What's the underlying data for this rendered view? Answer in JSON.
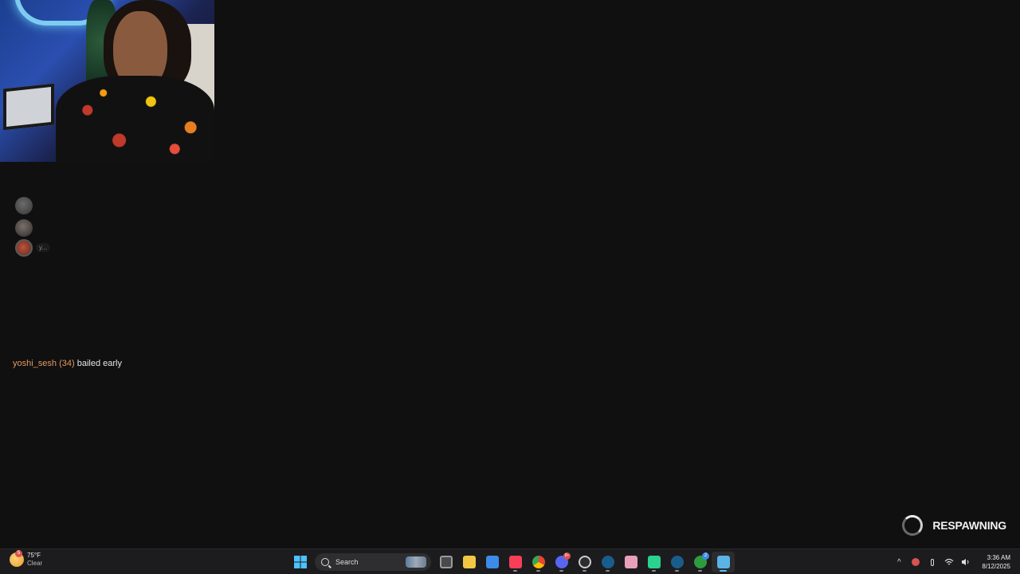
{
  "stream": {
    "webcam_label": "",
    "viewer_avatars": [
      {
        "label": ""
      },
      {
        "label": ""
      },
      {
        "label": "y..."
      }
    ],
    "event": {
      "user": "yoshi_sesh (34)",
      "text": "bailed early"
    },
    "respawn_label": "RESPAWNING"
  },
  "taskbar": {
    "weather": {
      "temp": "75°F",
      "condition": "Clear",
      "badge": "5"
    },
    "search_placeholder": "Search",
    "apps": [
      {
        "name": "start-button",
        "color": "#3aa0ff"
      },
      {
        "name": "task-view",
        "color": "#bdbdbd"
      },
      {
        "name": "file-explorer",
        "color": "#f2c744"
      },
      {
        "name": "microsoft-store",
        "color": "#3d8be8"
      },
      {
        "name": "music",
        "color": "#fa3e5a"
      },
      {
        "name": "chrome",
        "color": "#34a853"
      },
      {
        "name": "discord",
        "color": "#5865f2",
        "badge": "9+"
      },
      {
        "name": "obs",
        "color": "#2d2d2d"
      },
      {
        "name": "steam",
        "color": "#1b5d8a"
      },
      {
        "name": "app-pink",
        "color": "#e8a0b8"
      },
      {
        "name": "app-green",
        "color": "#2bd18f"
      },
      {
        "name": "steam-2",
        "color": "#1b5d8a"
      },
      {
        "name": "xbox",
        "color": "#2e9b3e",
        "badge": "2"
      },
      {
        "name": "active-app",
        "color": "#5ab4e6"
      }
    ],
    "tray": {
      "time": "3:36 AM",
      "date": "8/12/2025"
    }
  }
}
